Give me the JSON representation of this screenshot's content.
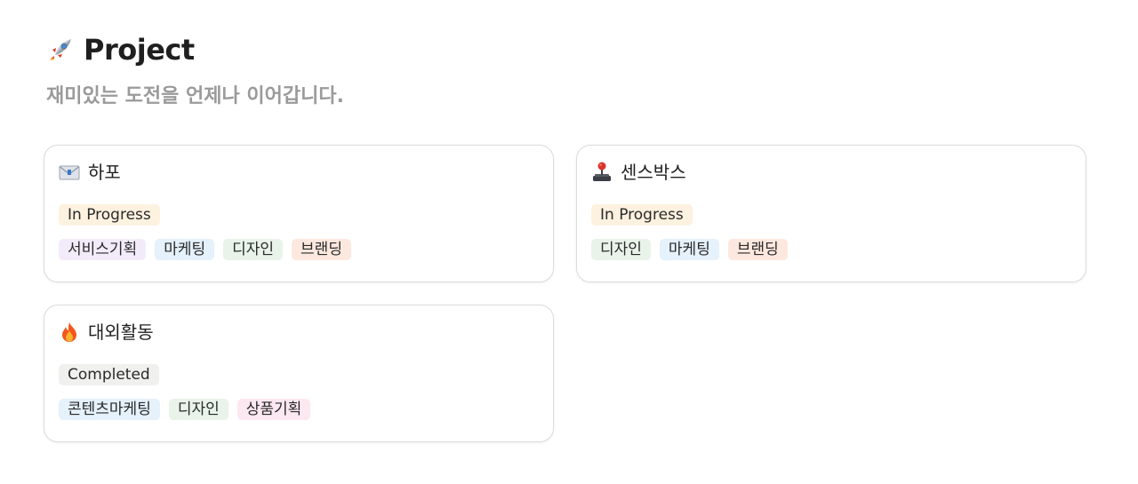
{
  "page": {
    "title": "Project",
    "title_icon": "rocket-icon",
    "subtitle": "재미있는 도전을 언제나 이어갑니다."
  },
  "colors": {
    "status_in_progress": "#fdf1e0",
    "status_completed": "#f0f0ee",
    "tag_purple": "#f3ebfa",
    "tag_blue": "#e5f1fb",
    "tag_green": "#e9f3ea",
    "tag_orange": "#fde8df",
    "tag_pink": "#fce8f1"
  },
  "projects": [
    {
      "title": "하포",
      "icon": "envelope-icon",
      "status": "In Progress",
      "tags": [
        "서비스기획",
        "마케팅",
        "디자인",
        "브랜딩"
      ]
    },
    {
      "title": "센스박스",
      "icon": "joystick-icon",
      "status": "In Progress",
      "tags": [
        "디자인",
        "마케팅",
        "브랜딩"
      ]
    },
    {
      "title": "대외활동",
      "icon": "fire-icon",
      "status": "Completed",
      "tags": [
        "콘텐츠마케팅",
        "디자인",
        "상품기획"
      ]
    }
  ]
}
